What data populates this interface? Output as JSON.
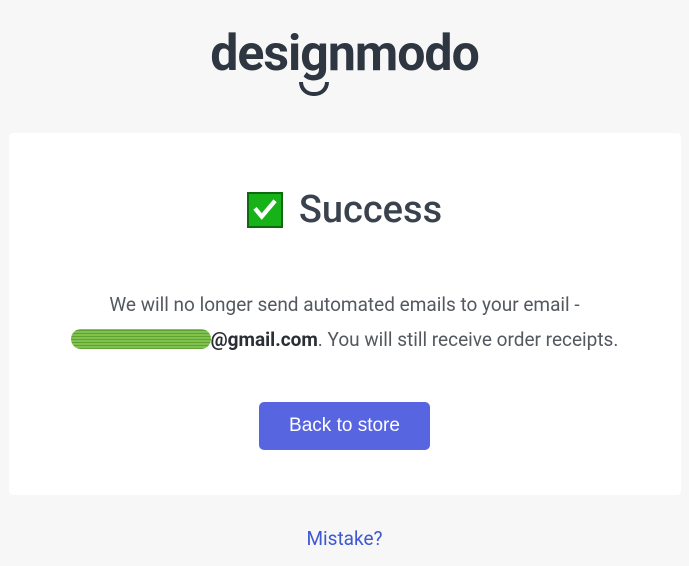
{
  "brand": {
    "name": "designmodo"
  },
  "success": {
    "heading": "Success",
    "message_prefix": "We will no longer send automated emails to your email - ",
    "email_domain": "@gmail.com",
    "message_suffix": ". You will still receive order receipts."
  },
  "actions": {
    "back_button": "Back to store",
    "mistake_link": "Mistake?"
  }
}
